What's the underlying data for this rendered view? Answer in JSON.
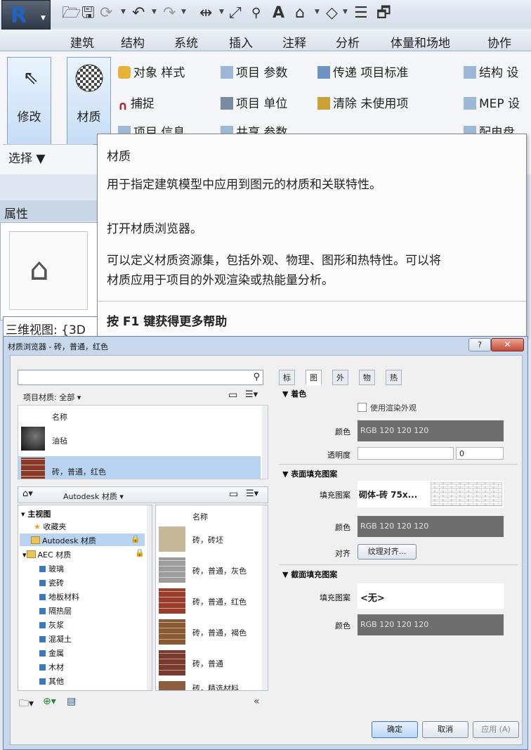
{
  "qat": {
    "icons": [
      "open-icon",
      "save-icon",
      "sync-icon",
      "undo-icon",
      "redo-icon",
      "measure-icon",
      "dimension-icon",
      "tag-icon",
      "text-icon",
      "3d-view-icon",
      "section-icon",
      "thin-lines-icon",
      "close-windows-icon"
    ],
    "text_tool": "A"
  },
  "menu": [
    "建筑",
    "结构",
    "系统",
    "插入",
    "注释",
    "分析",
    "体量和场地",
    "协作"
  ],
  "ribbon": {
    "modify": "修改",
    "material": "材质",
    "select": "选择 ▼",
    "items": [
      {
        "label": "对象 样式"
      },
      {
        "label": "捕捉"
      },
      {
        "label": "项目 信息"
      },
      {
        "label": "项目 参数"
      },
      {
        "label": "项目 单位"
      },
      {
        "label": "共享 参数"
      },
      {
        "label": "传递 项目标准"
      },
      {
        "label": "清除 未使用项"
      },
      {
        "label": "结构 设"
      },
      {
        "label": "MEP 设"
      },
      {
        "label": "配电盘"
      }
    ]
  },
  "props": {
    "header": "属性",
    "view": "三维视图: {3D"
  },
  "tooltip": {
    "title": "材质",
    "line1": "用于指定建筑模型中应用到图元的材质和关联特性。",
    "line2": "打开材质浏览器。",
    "line3a": "可以定义材质资源集，包括外观、物理、图形和热特性。可以将",
    "line3b": "材质应用于项目的外观渲染或热能量分析。",
    "help": "按 F1 键获得更多帮助"
  },
  "dialog": {
    "title": "材质浏览器 - 砖，普通，红色",
    "help": "?",
    "close": "✕",
    "search_placeholder": "",
    "project_filter": "项目材质: 全部 ▾",
    "name_header": "名称",
    "project_materials": [
      "油毡",
      "砖，普通，红色"
    ],
    "library_name": "Autodesk 材质 ▾",
    "tree": [
      "主视图",
      "收藏夹",
      "Autodesk 材质",
      "AEC 材质",
      "玻璃",
      "瓷砖",
      "地板材料",
      "隔热层",
      "灰浆",
      "混凝土",
      "金属",
      "木材",
      "其他"
    ],
    "library_materials": [
      "砖，砖坯",
      "砖，普通，灰色",
      "砖，普通，红色",
      "砖，普通，褐色",
      "砖，普通",
      "砖，精选材料"
    ],
    "tabs": [
      "标识",
      "图形",
      "外观",
      "物理",
      "热度"
    ],
    "active_tab": "图形",
    "shading": {
      "section": "▼ 着色",
      "use_render": "使用渲染外观",
      "color_label": "颜色",
      "color": "RGB 120 120 120",
      "transparency_label": "透明度",
      "transparency": "0"
    },
    "surface": {
      "section": "▼ 表面填充图案",
      "pattern_label": "填充图案",
      "pattern": "砌体-砖 75x...",
      "color_label": "颜色",
      "color": "RGB 120 120 120",
      "align_label": "对齐",
      "align": "纹理对齐..."
    },
    "cut": {
      "section": "▼ 截面填充图案",
      "pattern_label": "填充图案",
      "pattern": "<无>",
      "color_label": "颜色",
      "color": "RGB 120 120 120"
    },
    "ok": "确定",
    "cancel": "取消",
    "apply": "应用 (A)",
    "collapse": "«"
  }
}
